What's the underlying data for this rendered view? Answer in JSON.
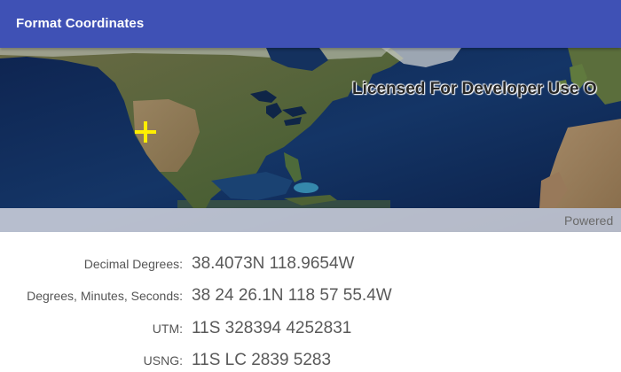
{
  "app": {
    "title": "Format Coordinates"
  },
  "map": {
    "watermark": "Licensed For Developer Use O",
    "attribution": "Powered",
    "marker_icon": "crosshair-plus-icon",
    "marker_color": "#ffef00",
    "basemap": "imagery"
  },
  "coordinates": {
    "decimal_degrees": {
      "label": "Decimal Degrees:",
      "value": "38.4073N 118.9654W"
    },
    "dms": {
      "label": "Degrees, Minutes, Seconds:",
      "value": "38 24 26.1N 118 57 55.4W"
    },
    "utm": {
      "label": "UTM:",
      "value": "11S 328394 4252831"
    },
    "usng": {
      "label": "USNG:",
      "value": "11S LC 2839 5283"
    }
  },
  "colors": {
    "appbar": "#3f51b5",
    "ocean": "#102a55",
    "land": "#5b6b3a"
  }
}
